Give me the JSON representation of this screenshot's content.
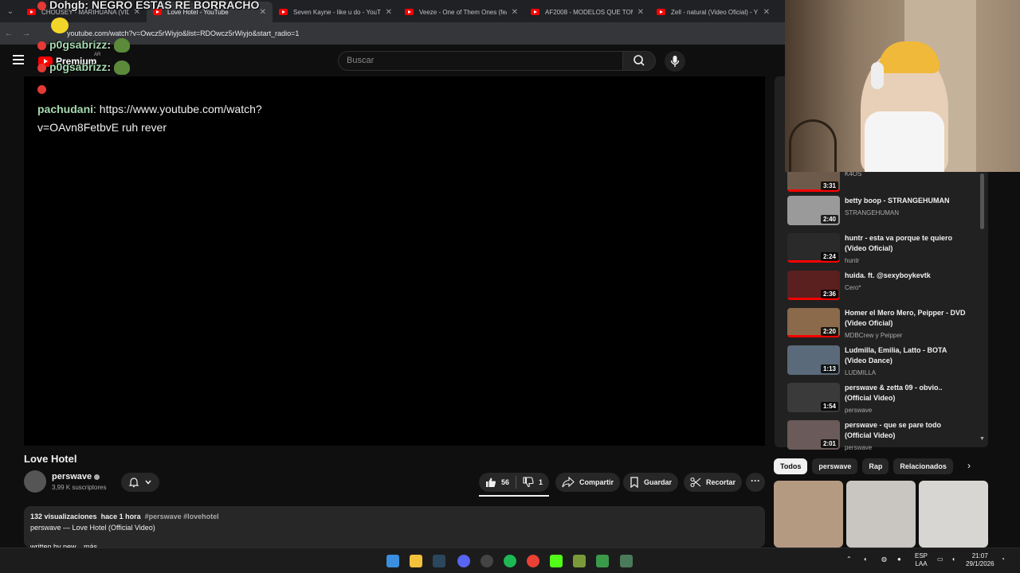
{
  "browser": {
    "tabs": [
      {
        "title": "CHOUSEY - MARIHUANA (VID",
        "active": false
      },
      {
        "title": "Love Hotel - YouTube",
        "active": true
      },
      {
        "title": "Seven Kayne - like u do - YouTu",
        "active": false
      },
      {
        "title": "Veeze - One of Them Ones (fea",
        "active": false
      },
      {
        "title": "AF2008 - MODELOS QUE TOM",
        "active": false
      },
      {
        "title": "Zell - natural (Video Oficial) - Y",
        "active": false
      }
    ],
    "url": "youtube.com/watch?v=Owcz5rWiyjo&list=RDOwcz5rWiyjo&start_radio=1"
  },
  "youtube": {
    "logo_text": "Premium",
    "logo_region": "AR",
    "search_placeholder": "Buscar"
  },
  "chat": {
    "lines": [
      {
        "user": "Dohgb",
        "text": ": NEGRO ESTAS RE BORRACHO"
      },
      {
        "user": "p0gsabrizz",
        "text": ":"
      },
      {
        "user": "p0gsabrizz",
        "text": ":"
      }
    ],
    "message_user": "pachudani",
    "message_text": ": https://www.youtube.com/watch?v=OAvn8FetbvE ruh rever"
  },
  "video": {
    "title": "Love Hotel",
    "channel": "perswave",
    "subscribers": "3,99 K suscriptores",
    "likes": "56",
    "dislikes": "1",
    "share_label": "Compartir",
    "save_label": "Guardar",
    "clip_label": "Recortar",
    "more_label": "···",
    "views": "132 visualizaciones",
    "age": "hace 1 hora",
    "tags": "#perswave #lovehotel",
    "desc_line": "perswave — Love Hotel (Official Video)",
    "desc_cut": "written by pew... más"
  },
  "recommendations": [
    {
      "title": "",
      "channel": "K4OS",
      "duration": "3:31",
      "thumb_color": "#6d5a4a",
      "progress": 1.0
    },
    {
      "title": "betty boop - STRANGEHUMAN",
      "channel": "STRANGEHUMAN",
      "duration": "2:40",
      "thumb_color": "#9a9a9a",
      "progress": 0.0
    },
    {
      "title": "huntr - esta va porque te quiero (Video Oficial)",
      "channel": "huntr",
      "duration": "2:24",
      "thumb_color": "#2a2a2a",
      "progress": 1.0
    },
    {
      "title": "huida. ft. @sexyboykevtk",
      "channel": "Cero*",
      "duration": "2:36",
      "thumb_color": "#5a1f1f",
      "progress": 1.0
    },
    {
      "title": "Homer el Mero Mero, Peipper - DVD (Video Oficial)",
      "channel": "MDBCrew y Peipper",
      "duration": "2:20",
      "thumb_color": "#8a6a4a",
      "progress": 1.0
    },
    {
      "title": "Ludmilla, Emilia, Latto - BOTA (Video Dance)",
      "channel": "LUDMILLA",
      "duration": "1:13",
      "thumb_color": "#5a6a7a",
      "progress": 0.0
    },
    {
      "title": "perswave & zetta 09 - obvio.. (Official Video)",
      "channel": "perswave",
      "duration": "1:54",
      "thumb_color": "#3a3a3a",
      "progress": 0.0
    },
    {
      "title": "perswave - que se pare todo (Official Video)",
      "channel": "perswave",
      "duration": "2:01",
      "thumb_color": "#6a5a5a",
      "progress": 0.0
    }
  ],
  "chips": [
    "Todos",
    "perswave",
    "Rap",
    "Relacionados"
  ],
  "taskbar": {
    "lang": "ESP",
    "lang2": "LAA",
    "time": "21:07",
    "date": "29/1/2026"
  },
  "colors": {
    "brand_red": "#ff0000",
    "background": "#0f0f0f",
    "chip_selected": "#f1f1f1"
  }
}
